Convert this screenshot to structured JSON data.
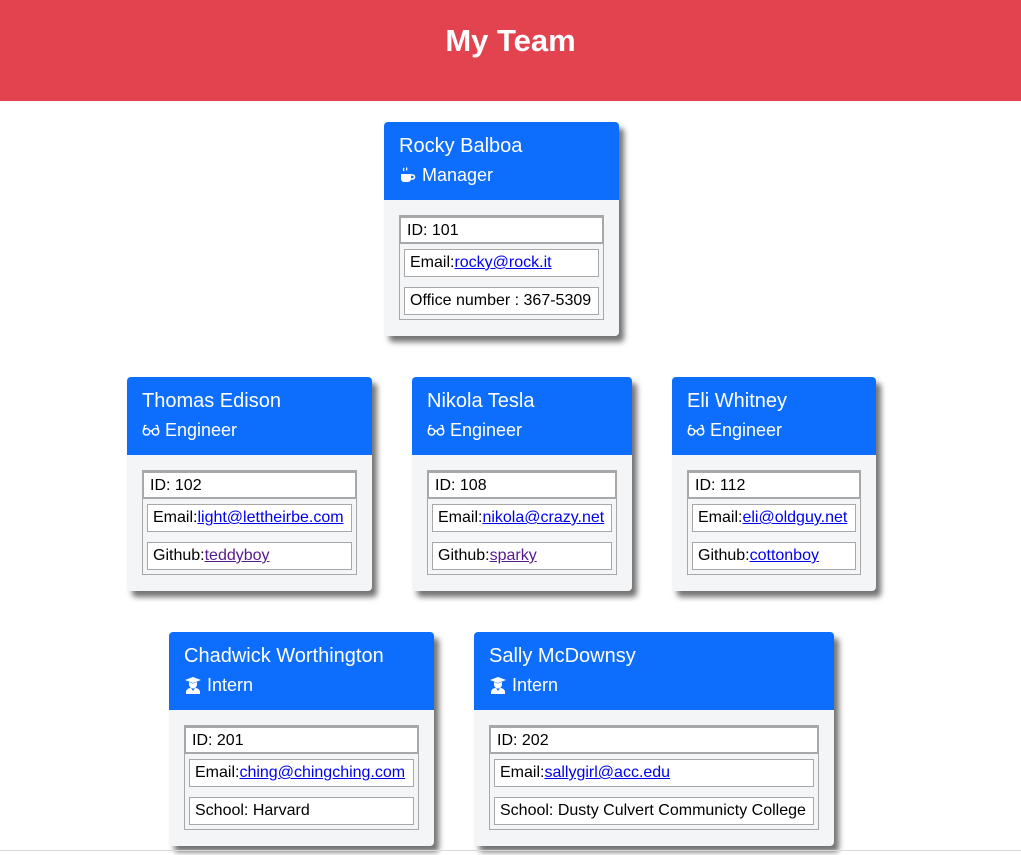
{
  "header": {
    "title": "My Team"
  },
  "colors": {
    "header_bg": "#e3434f",
    "card_head_bg": "#0d6efd",
    "card_bg": "#f4f5f7"
  },
  "manager": {
    "name": "Rocky Balboa",
    "role": "Manager",
    "role_icon": "mug-icon",
    "id": "ID: 101",
    "email_label": "Email:",
    "email": "rocky@rock.it",
    "office_label": "Office number : 367-5309"
  },
  "engineers": [
    {
      "name": "Thomas Edison",
      "role": "Engineer",
      "role_icon": "glasses-icon",
      "id": "ID: 102",
      "email_label": "Email:",
      "email": "light@lettheirbe.com",
      "github_label": "Github:",
      "github": "teddyboy"
    },
    {
      "name": "Nikola Tesla",
      "role": "Engineer",
      "role_icon": "glasses-icon",
      "id": "ID: 108",
      "email_label": "Email:",
      "email": "nikola@crazy.net",
      "github_label": "Github:",
      "github": "sparky"
    },
    {
      "name": "Eli Whitney",
      "role": "Engineer",
      "role_icon": "glasses-icon",
      "id": "ID: 112",
      "email_label": "Email:",
      "email": "eli@oldguy.net",
      "github_label": "Github:",
      "github": "cottonboy"
    }
  ],
  "interns": [
    {
      "name": "Chadwick Worthington",
      "role": "Intern",
      "role_icon": "graduate-icon",
      "id": "ID: 201",
      "email_label": "Email:",
      "email": "ching@chingching.com",
      "school_label": "School: Harvard"
    },
    {
      "name": "Sally McDownsy",
      "role": "Intern",
      "role_icon": "graduate-icon",
      "id": "ID: 202",
      "email_label": "Email:",
      "email": "sallygirl@acc.edu",
      "school_label": "School: Dusty Culvert Communicty College"
    }
  ]
}
